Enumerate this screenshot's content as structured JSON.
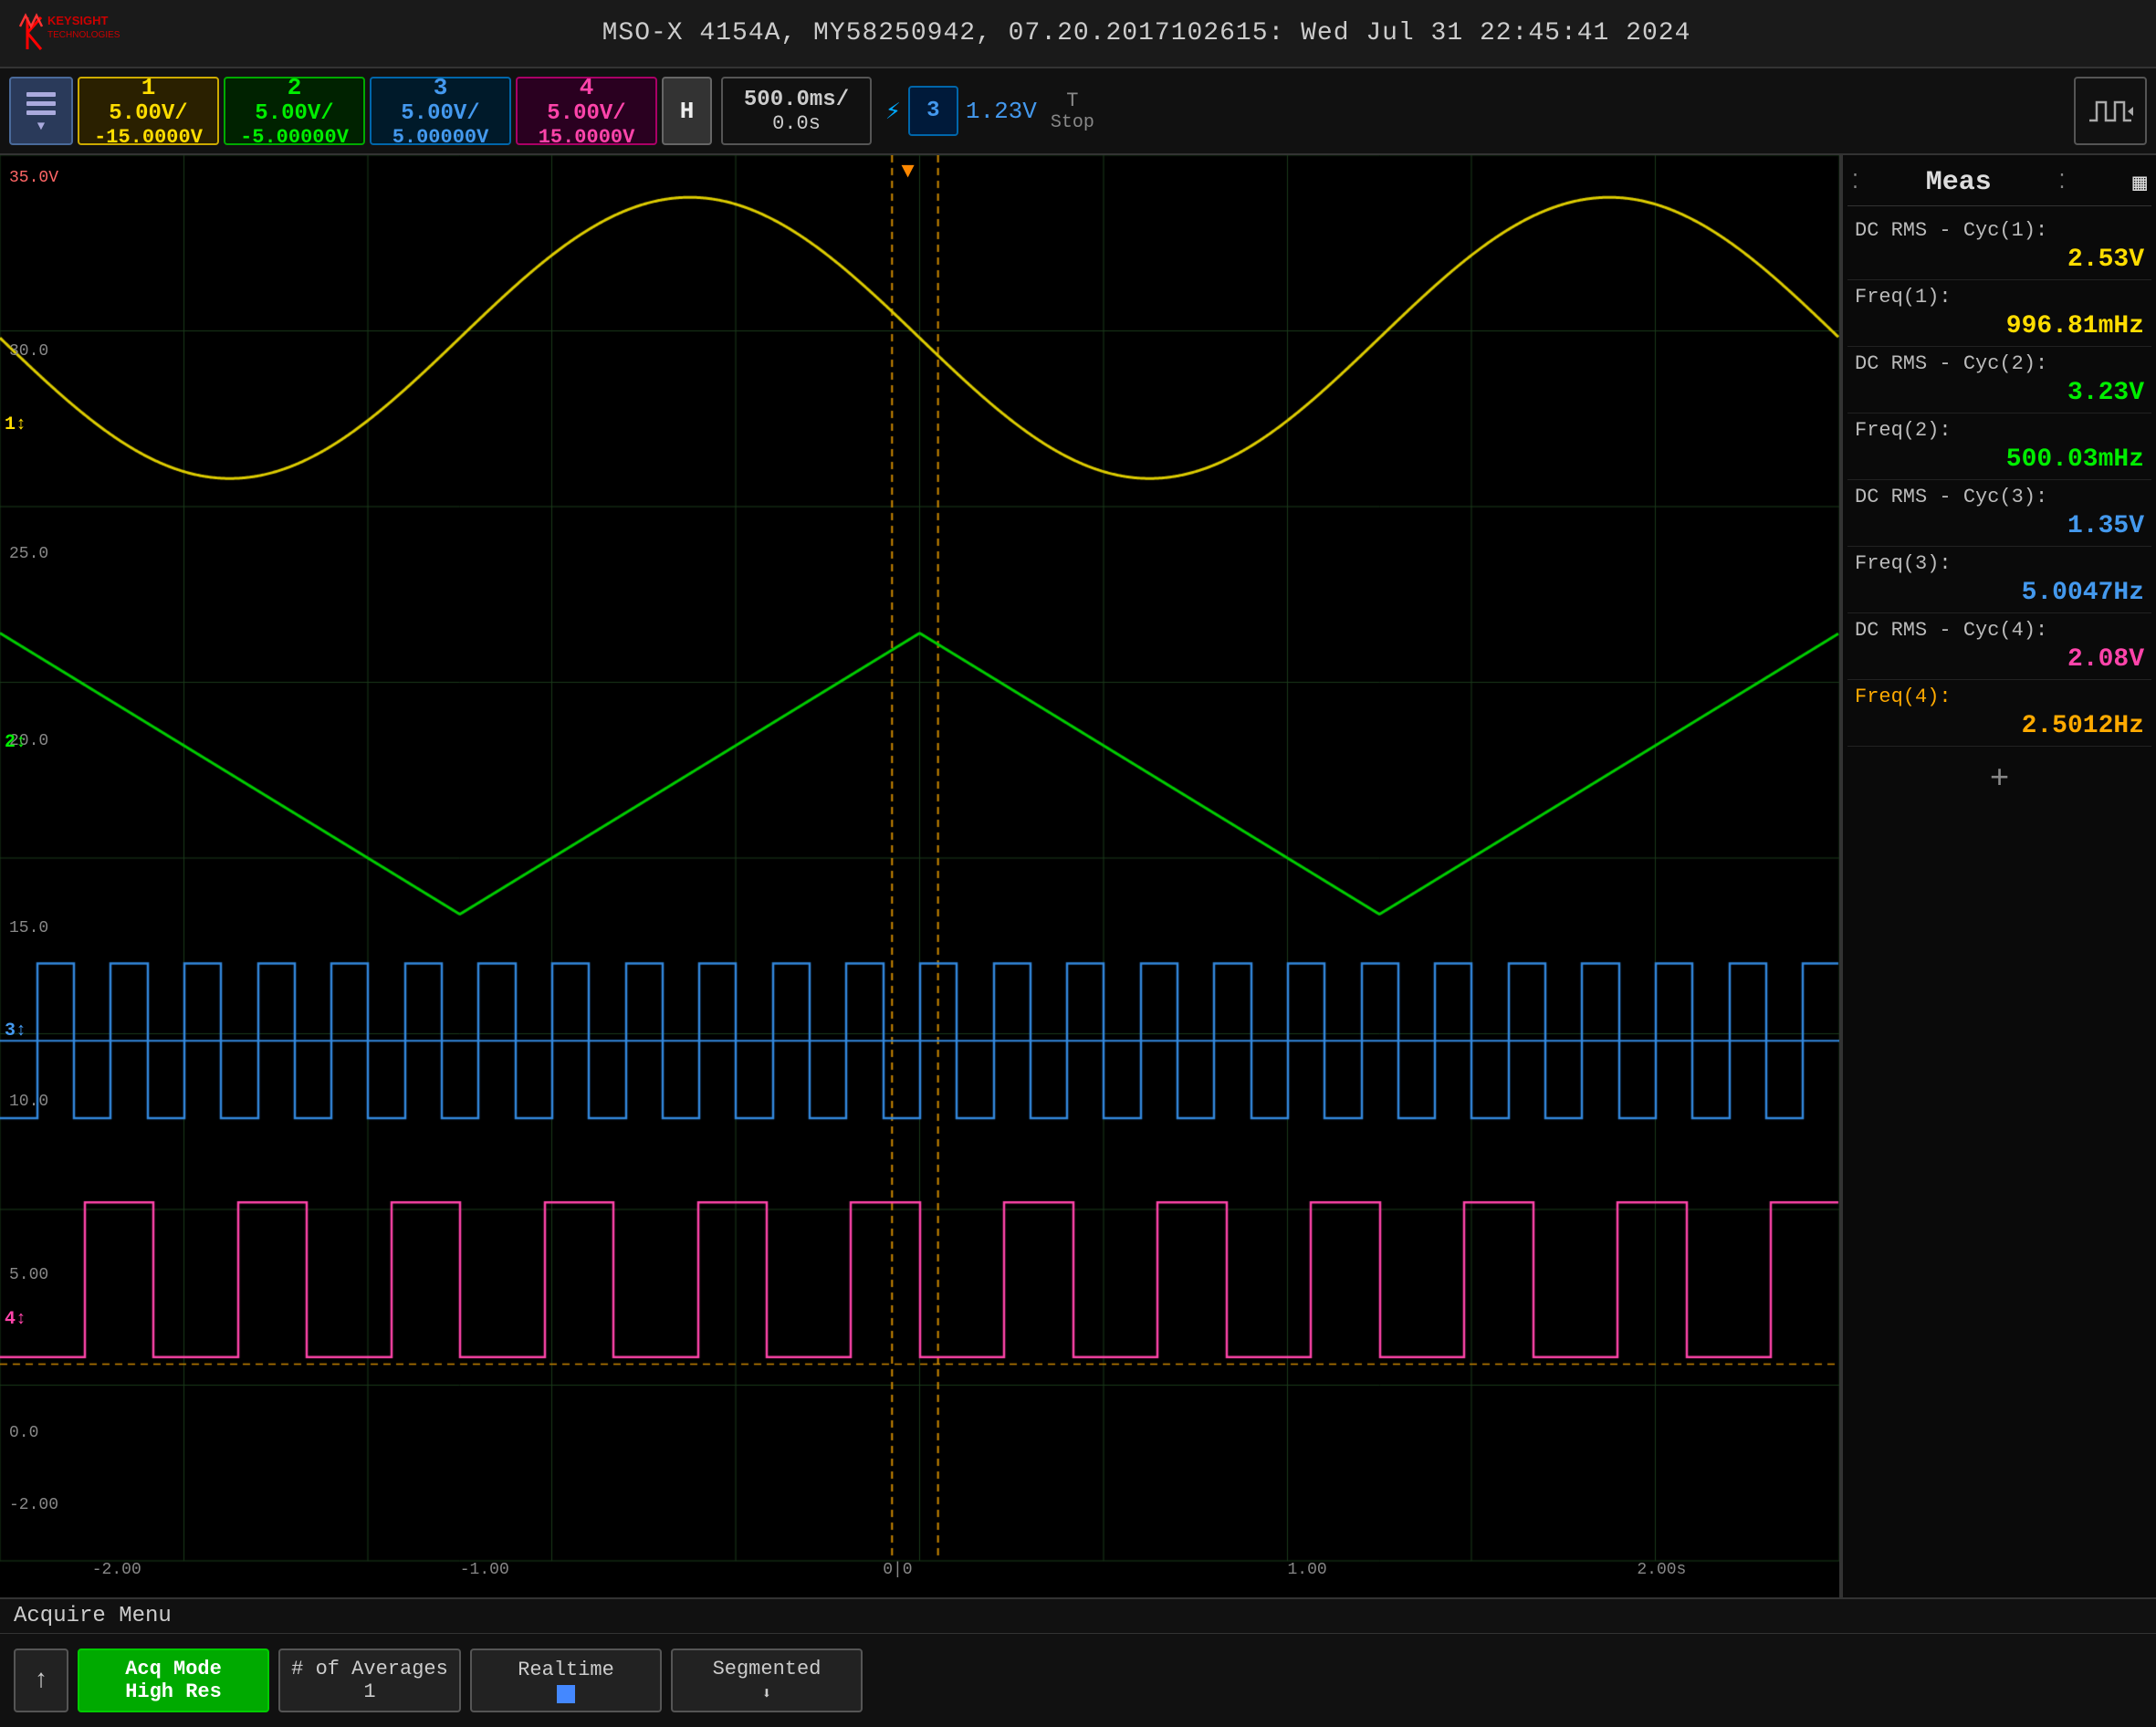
{
  "header": {
    "title": "MSO-X 4154A, MY58250942, 07.20.2017102615: Wed Jul 31 22:45:41 2024"
  },
  "controls": {
    "ch1": {
      "scale": "5.00V/",
      "offset": "-15.0000V"
    },
    "ch2": {
      "scale": "5.00V/",
      "offset": "-5.00000V"
    },
    "ch3": {
      "scale": "5.00V/",
      "offset": "5.00000V"
    },
    "ch4": {
      "scale": "5.00V/",
      "offset": "15.0000V"
    },
    "timebase": {
      "scale": "500.0ms/",
      "offset": "0.0s"
    },
    "h_label": "H",
    "trigger": {
      "icon": "⚡",
      "channel": "3",
      "value": "1.23V"
    },
    "run_stop": "Stop",
    "t_label": "T"
  },
  "measurements": {
    "title": "Meas",
    "items": [
      {
        "label": "DC RMS - Cyc(1):",
        "value": "2.53V",
        "ch": "ch1"
      },
      {
        "label": "Freq(1):",
        "value": "996.81mHz",
        "ch": "ch1"
      },
      {
        "label": "DC RMS - Cyc(2):",
        "value": "3.23V",
        "ch": "ch2"
      },
      {
        "label": "Freq(2):",
        "value": "500.03mHz",
        "ch": "ch2"
      },
      {
        "label": "DC RMS - Cyc(3):",
        "value": "1.35V",
        "ch": "ch3"
      },
      {
        "label": "Freq(3):",
        "value": "5.0047Hz",
        "ch": "ch3"
      },
      {
        "label": "DC RMS - Cyc(4):",
        "value": "2.08V",
        "ch": "ch4"
      },
      {
        "label": "Freq(4):",
        "value": "2.5012Hz",
        "ch": "freq4"
      }
    ],
    "add_btn": "+"
  },
  "bottom": {
    "acquire_menu_label": "Acquire Menu",
    "acq_mode_label": "Acq Mode",
    "acq_mode_value": "High Res",
    "avg_label": "# of Averages",
    "avg_value": "1",
    "realtime_label": "Realtime",
    "segmented_label": "Segmented"
  },
  "grid": {
    "x_labels": [
      "-2.00",
      "-1.00",
      "0|0",
      "1.00",
      "2.00s"
    ],
    "y_labels": [
      "35.0V",
      "30.0",
      "25.0",
      "20.0",
      "15.0",
      "10.0",
      "5.00",
      "0.0",
      "-2.00"
    ],
    "ch_markers": [
      {
        "label": "1↕",
        "top_pct": 20,
        "color": "#ffdd00"
      },
      {
        "label": "2↕",
        "top_pct": 42,
        "color": "#00ee00"
      },
      {
        "label": "3↕",
        "top_pct": 62,
        "color": "#4499ee"
      },
      {
        "label": "4↕",
        "top_pct": 82,
        "color": "#ff44aa"
      }
    ]
  }
}
